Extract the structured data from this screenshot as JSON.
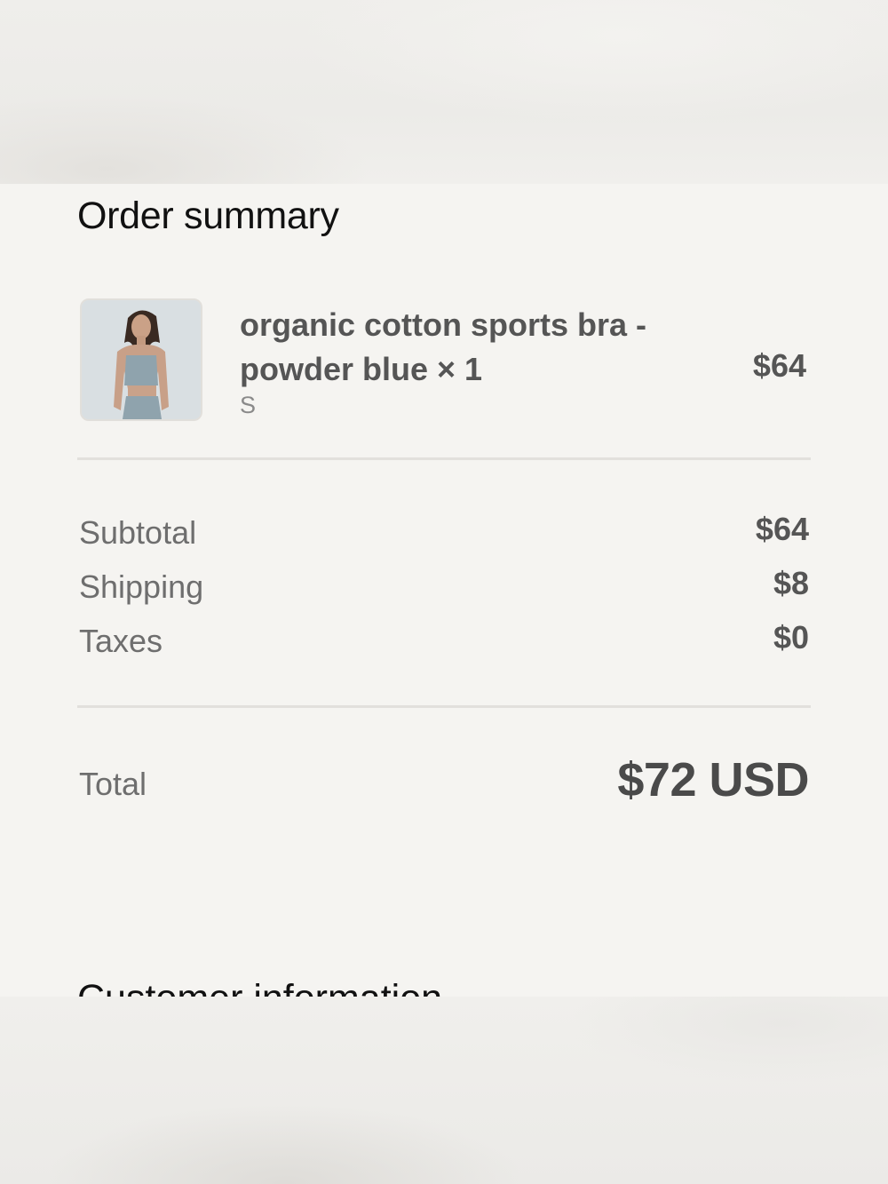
{
  "order_summary": {
    "title": "Order summary",
    "item": {
      "name": "organic cotton sports bra - powder blue × 1",
      "variant": "S",
      "price": "$64",
      "thumbnail_icon": "product-photo-sports-bra"
    },
    "costs": [
      {
        "label": "Subtotal",
        "value": "$64"
      },
      {
        "label": "Shipping",
        "value": "$8"
      },
      {
        "label": "Taxes",
        "value": "$0"
      }
    ],
    "total": {
      "label": "Total",
      "value": "$72 USD"
    }
  },
  "customer_information": {
    "title": "Customer information"
  },
  "colors": {
    "background": "#f5f4f1",
    "heading_text": "#111111",
    "label_text": "#6e6e6e",
    "value_text": "#555555",
    "divider": "#e2e0dc"
  }
}
